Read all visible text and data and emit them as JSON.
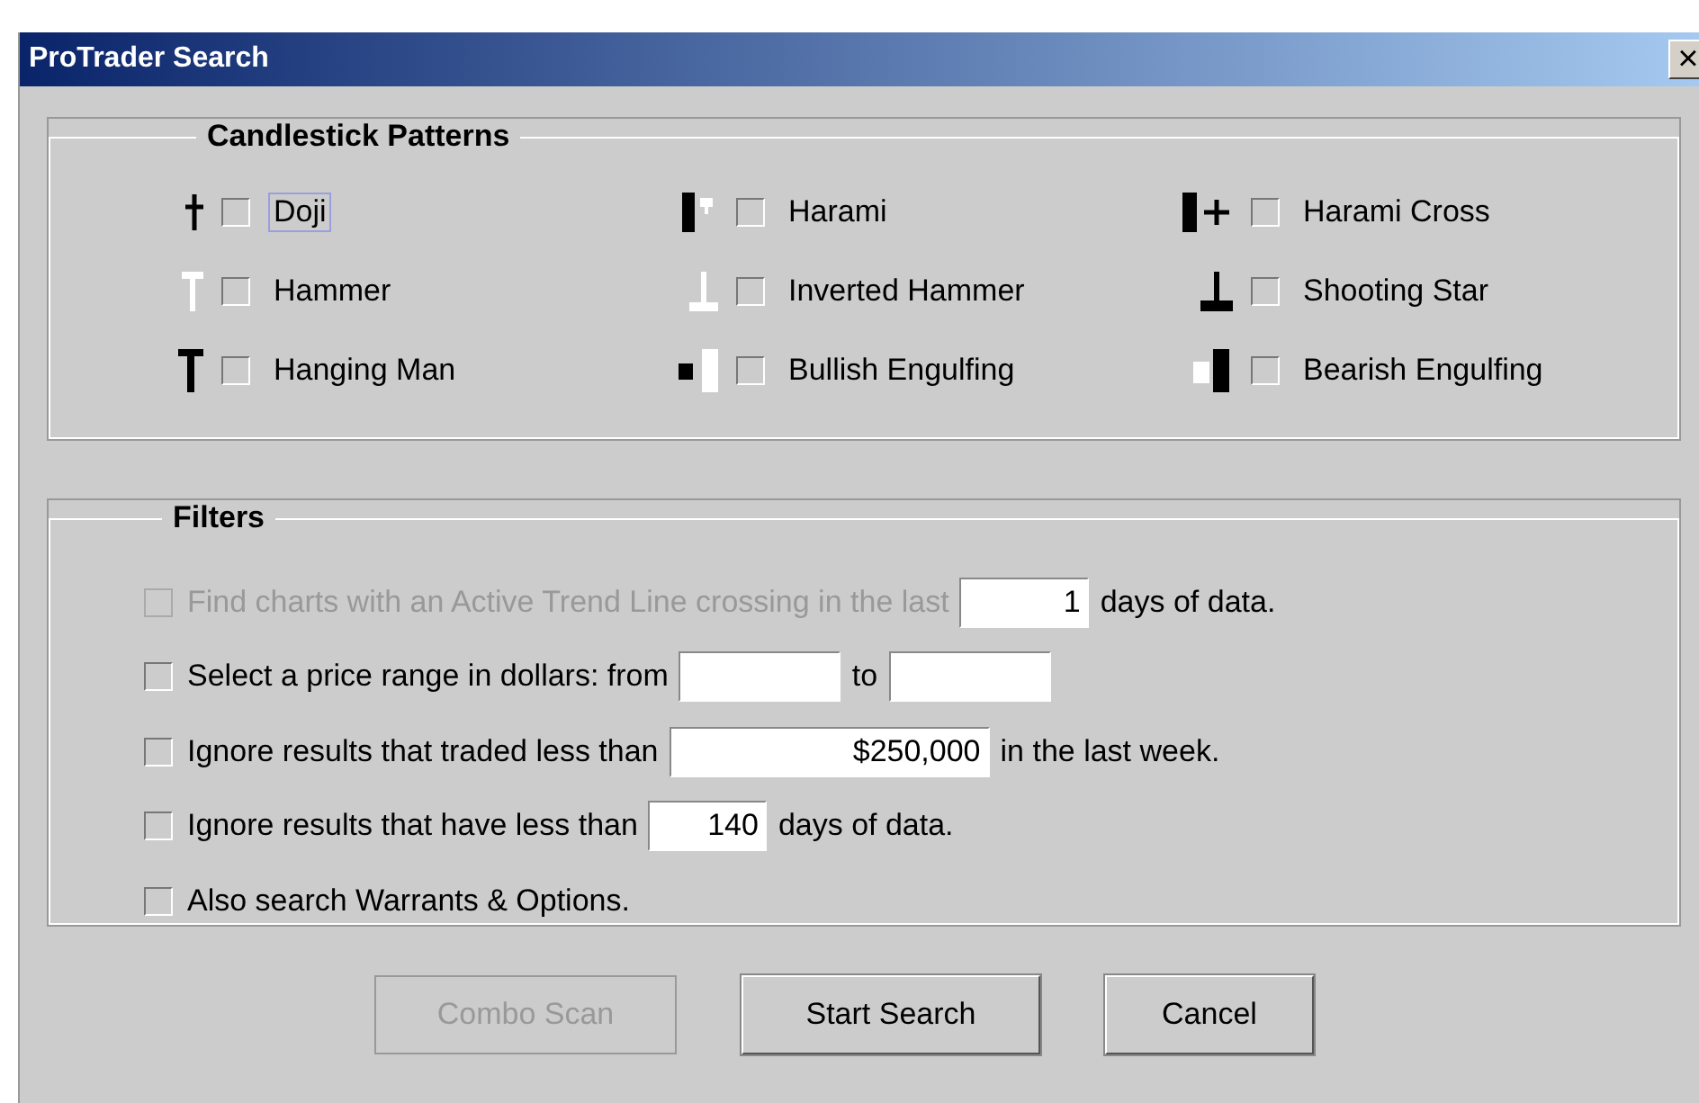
{
  "window": {
    "title": "ProTrader Search",
    "close": "×"
  },
  "candlestick_patterns": {
    "title": "Candlestick Patterns",
    "patterns": [
      {
        "kind": "doji",
        "label": "Doji",
        "checked": false,
        "focused": true
      },
      {
        "kind": "harami",
        "label": "Harami",
        "checked": false,
        "focused": false
      },
      {
        "kind": "harami-cross",
        "label": "Harami Cross",
        "checked": false,
        "focused": false
      },
      {
        "kind": "hammer",
        "label": "Hammer",
        "checked": false,
        "focused": false
      },
      {
        "kind": "inverted-hammer",
        "label": "Inverted Hammer",
        "checked": false,
        "focused": false
      },
      {
        "kind": "shooting-star",
        "label": "Shooting Star",
        "checked": false,
        "focused": false
      },
      {
        "kind": "hanging-man",
        "label": "Hanging Man",
        "checked": false,
        "focused": false
      },
      {
        "kind": "bullish-engulfing",
        "label": "Bullish Engulfing",
        "checked": false,
        "focused": false
      },
      {
        "kind": "bearish-engulfing",
        "label": "Bearish Engulfing",
        "checked": false,
        "focused": false
      }
    ]
  },
  "filters": {
    "title": "Filters",
    "rows": [
      {
        "checked": false,
        "disabled": true,
        "segments": [
          {
            "kind": "text",
            "text": "Find charts with an Active Trend Line crossing in the last"
          },
          {
            "kind": "field",
            "value": "1"
          },
          {
            "kind": "text",
            "text": "days of data.",
            "enabled": true
          }
        ]
      },
      {
        "checked": false,
        "disabled": false,
        "segments": [
          {
            "kind": "text",
            "text": "Select a price range in dollars:  from"
          },
          {
            "kind": "field"
          },
          {
            "kind": "text",
            "text": "to"
          },
          {
            "kind": "field"
          }
        ]
      },
      {
        "checked": false,
        "disabled": false,
        "segments": [
          {
            "kind": "text",
            "text": "Ignore results that traded less than"
          },
          {
            "kind": "field",
            "value": "$250,000"
          },
          {
            "kind": "text",
            "text": "in the last week."
          }
        ]
      },
      {
        "checked": false,
        "disabled": false,
        "segments": [
          {
            "kind": "text",
            "text": "Ignore results that have less than"
          },
          {
            "kind": "field",
            "value": "140"
          },
          {
            "kind": "text",
            "text": "days of data."
          }
        ]
      },
      {
        "checked": false,
        "disabled": false,
        "segments": [
          {
            "kind": "text",
            "text": "Also search Warrants & Options."
          }
        ]
      }
    ]
  },
  "buttons": [
    {
      "label": "Combo Scan",
      "disabled": true
    },
    {
      "label": "Start Search",
      "disabled": false
    },
    {
      "label": "Cancel",
      "disabled": false
    }
  ]
}
